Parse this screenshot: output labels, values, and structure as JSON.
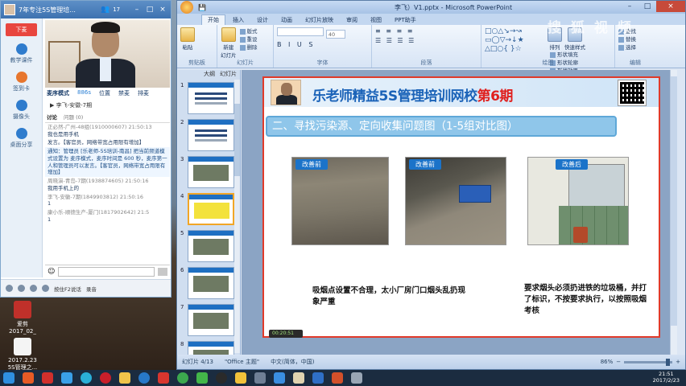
{
  "colors": {
    "accent": "#1b63b8",
    "alert": "#e0201e",
    "section": "#8fc6ea"
  },
  "desktop": {
    "icons": [
      {
        "label": "爱剪\n2017_02_",
        "icon": "video-file-icon"
      },
      {
        "label": "2017.2.23\n5S管理之...",
        "icon": "document-icon"
      }
    ]
  },
  "chat": {
    "title": "7年专注5S管理培...",
    "viewer_count": "17",
    "down_button": "下麦",
    "sidebar": [
      "教学课件",
      "签到卡",
      "摄像头",
      "桌面分享"
    ],
    "tabs": [
      "麦序模式",
      "886s",
      "位置",
      "禁麦",
      "排麦"
    ],
    "user_line": "李飞-安徽-7期",
    "msg_tabs": [
      "讨论",
      "问题 (0)"
    ],
    "messages": [
      {
        "meta": "正必然-广州-48组(1910000607) 21:50:13",
        "text": "我也是用手机"
      },
      {
        "meta": "",
        "text": "发言。【客官员，网络带宽占用限有增加】"
      },
      {
        "meta": "",
        "text": "通知：管理员 [乐老师-5S培训-南昌] 把当前频道模式设置为 麦序模式，麦序时间是 600 秒，麦序第一人和管理员可以发言。【客官员，网络带宽占用限有增加】",
        "notice": true
      },
      {
        "meta": "周晓演-青岛-7期(1938874605) 21:50:16",
        "text": "我用手机上的"
      },
      {
        "meta": "李飞-安徽-7期(1849903812) 21:50:16",
        "text": "1"
      },
      {
        "meta": "康小乐-顺德生产-厦门(1817902642) 21:5",
        "text": "1"
      }
    ],
    "bottom_bar": [
      "按住F2说话",
      "录音"
    ]
  },
  "ppt": {
    "window_title": "李飞）V1.pptx - Microsoft PowerPoint",
    "tabs": [
      "开始",
      "插入",
      "设计",
      "动画",
      "幻灯片放映",
      "审阅",
      "视图",
      "PPT助手"
    ],
    "ribbon_groups": [
      "剪贴板",
      "幻灯片",
      "字体",
      "段落",
      "绘图",
      "编辑"
    ],
    "ribbon_buttons": {
      "paste": "粘贴",
      "new_slide": "新建\n幻灯片",
      "layout": "版式",
      "reset": "重设",
      "delete": "删除",
      "arrange": "排列",
      "quick_styles": "快速样式",
      "find": "查找",
      "replace": "替换",
      "select": "选择",
      "fill": "形状填充",
      "outline": "形状轮廓",
      "effect": "形状效果"
    },
    "font_size": "40",
    "panel_tabs": [
      "大纲",
      "幻灯片"
    ],
    "thumb_numbers": [
      "1",
      "2",
      "3",
      "4",
      "5",
      "6",
      "7",
      "8"
    ],
    "active_slide": 4,
    "slide": {
      "title_main": "乐老师精益5S管理培训网校",
      "title_phase": "第6期",
      "section": "二、寻找污染源、定向收集问题图（1-5组对比图）",
      "photo_labels": [
        "改善前",
        "改善前",
        "改善后"
      ],
      "caption_left": "吸烟点设置不合理，太小厂房门口烟头乱扔现象严重",
      "caption_right": "要求烟头必须扔进铁的垃圾桶，并打了标识，不按要求执行，以按照吸烟考核",
      "timer": "00:20:51"
    },
    "status": {
      "slide_of": "幻灯片 4/13",
      "theme": "\"Office 主题\"",
      "lang": "中文(简体，中国)",
      "zoom": "86%"
    }
  },
  "watermark": "搜 狐 视 频",
  "taskbar": {
    "time": "21:51",
    "date": "2017/2/23"
  }
}
